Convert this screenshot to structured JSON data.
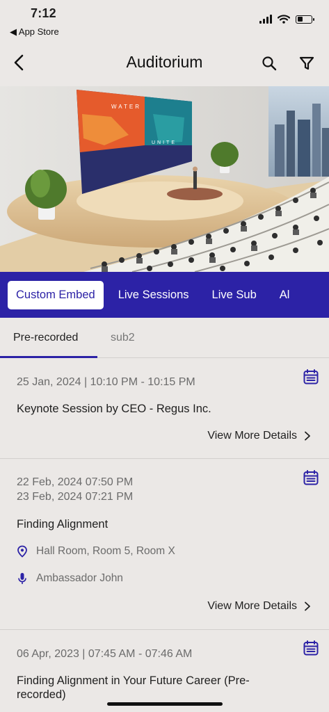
{
  "status": {
    "time": "7:12",
    "back_app": "◀ App Store",
    "battery_level": 0.4
  },
  "header": {
    "title": "Auditorium"
  },
  "hero": {
    "screen_left_text": "WATER",
    "screen_right_text": "UNITE"
  },
  "tabs": [
    {
      "label": "Custom Embed",
      "active": true
    },
    {
      "label": "Live Sessions",
      "active": false
    },
    {
      "label": "Live Sub",
      "active": false
    },
    {
      "label": "Al",
      "active": false
    }
  ],
  "sub_tabs": [
    {
      "label": "Pre-recorded",
      "active": true
    },
    {
      "label": "sub2",
      "active": false
    }
  ],
  "sessions": [
    {
      "date_line1": "25 Jan, 2024 | 10:10 PM - 10:15 PM",
      "title": "Keynote Session by CEO - Regus Inc.",
      "more": "View More Details"
    },
    {
      "date_line1": "22 Feb, 2024 07:50 PM",
      "date_line2": "23 Feb, 2024 07:21 PM",
      "title": "Finding Alignment",
      "location": "Hall Room, Room 5, Room X",
      "speaker": "Ambassador John",
      "more": "View More Details"
    },
    {
      "date_line1": "06 Apr, 2023 | 07:45 AM - 07:46 AM",
      "title_line1": "Finding Alignment in Your Future Career (Pre-",
      "title_line2": "recorded)"
    }
  ],
  "colors": {
    "accent": "#2c22a6",
    "background": "#ebe8e6"
  }
}
